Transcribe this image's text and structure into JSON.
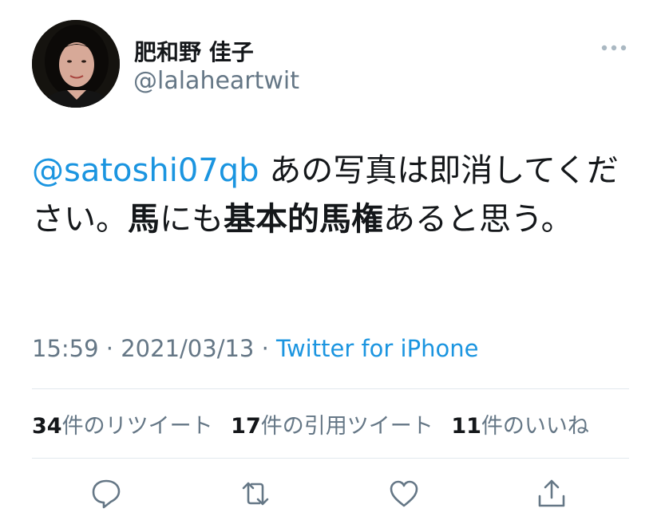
{
  "author": {
    "display_name": "肥和野 佳子",
    "handle": "@lalaheartwit"
  },
  "tweet": {
    "mention": "@satoshi07qb",
    "segments": [
      {
        "text": " あの写真は即消してください。",
        "bold": false
      },
      {
        "text": "馬",
        "bold": true
      },
      {
        "text": "にも",
        "bold": false
      },
      {
        "text": "基本的馬権",
        "bold": true
      },
      {
        "text": "あると思う。",
        "bold": false
      }
    ]
  },
  "meta": {
    "time": "15:59",
    "date": "2021/03/13",
    "separator": " · ",
    "source": "Twitter for iPhone"
  },
  "stats": {
    "retweets_count": "34",
    "retweets_label": "件のリツイート",
    "quotes_count": "17",
    "quotes_label": "件の引用ツイート",
    "likes_count": "11",
    "likes_label": "件のいいね"
  },
  "icons": {
    "more": "more-icon",
    "reply": "reply-icon",
    "retweet": "retweet-icon",
    "like": "like-icon",
    "share": "share-icon"
  },
  "colors": {
    "link": "#1b95e0",
    "secondary_text": "#657786",
    "primary_text": "#14171a",
    "divider": "#e1e8ed"
  }
}
